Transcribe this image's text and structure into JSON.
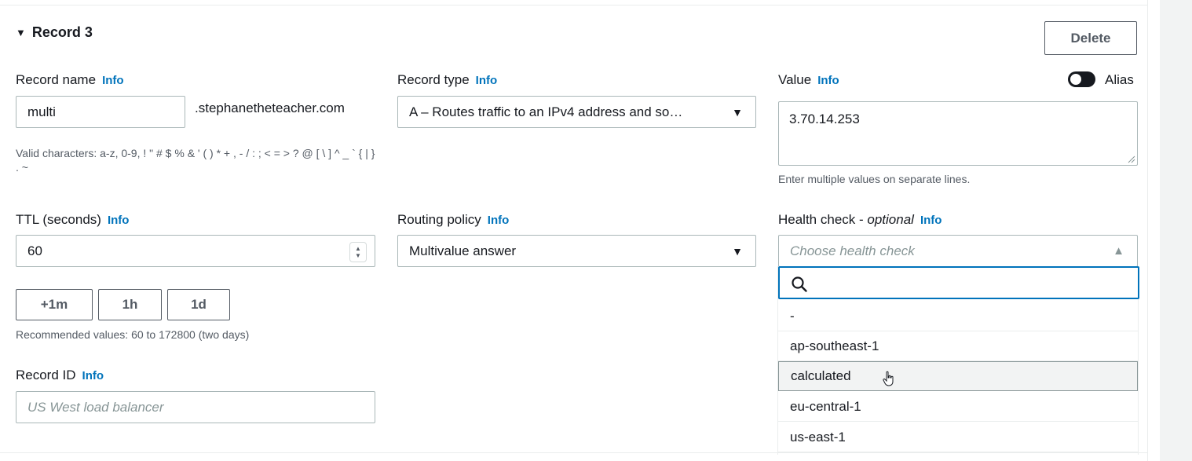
{
  "record": {
    "title": "Record 3",
    "delete_label": "Delete"
  },
  "record_name": {
    "label": "Record name",
    "info": "Info",
    "value": "multi",
    "domain_suffix": ".stephanetheteacher.com",
    "hint": "Valid characters: a-z, 0-9, ! \" # $ % & ' ( ) * + , - / : ; < = > ? @ [ \\ ] ^ _ ` { | } . ~"
  },
  "record_type": {
    "label": "Record type",
    "info": "Info",
    "value": "A – Routes traffic to an IPv4 address and so…"
  },
  "value_field": {
    "label": "Value",
    "info": "Info",
    "value": "3.70.14.253",
    "hint": "Enter multiple values on separate lines.",
    "alias_label": "Alias"
  },
  "ttl": {
    "label": "TTL (seconds)",
    "info": "Info",
    "value": "60",
    "buttons": [
      "+1m",
      "1h",
      "1d"
    ],
    "hint": "Recommended values: 60 to 172800 (two days)"
  },
  "routing_policy": {
    "label": "Routing policy",
    "info": "Info",
    "value": "Multivalue answer"
  },
  "health_check": {
    "label": "Health check - ",
    "label_optional": "optional",
    "info": "Info",
    "placeholder": "Choose health check",
    "options": [
      "-",
      "ap-southeast-1",
      "calculated",
      "eu-central-1",
      "us-east-1"
    ],
    "hovered_option": "calculated"
  },
  "record_id": {
    "label": "Record ID",
    "info": "Info",
    "placeholder": "US West load balancer"
  },
  "colors": {
    "link": "#0073bb",
    "text": "#16191f",
    "border": "#aab7b8"
  }
}
